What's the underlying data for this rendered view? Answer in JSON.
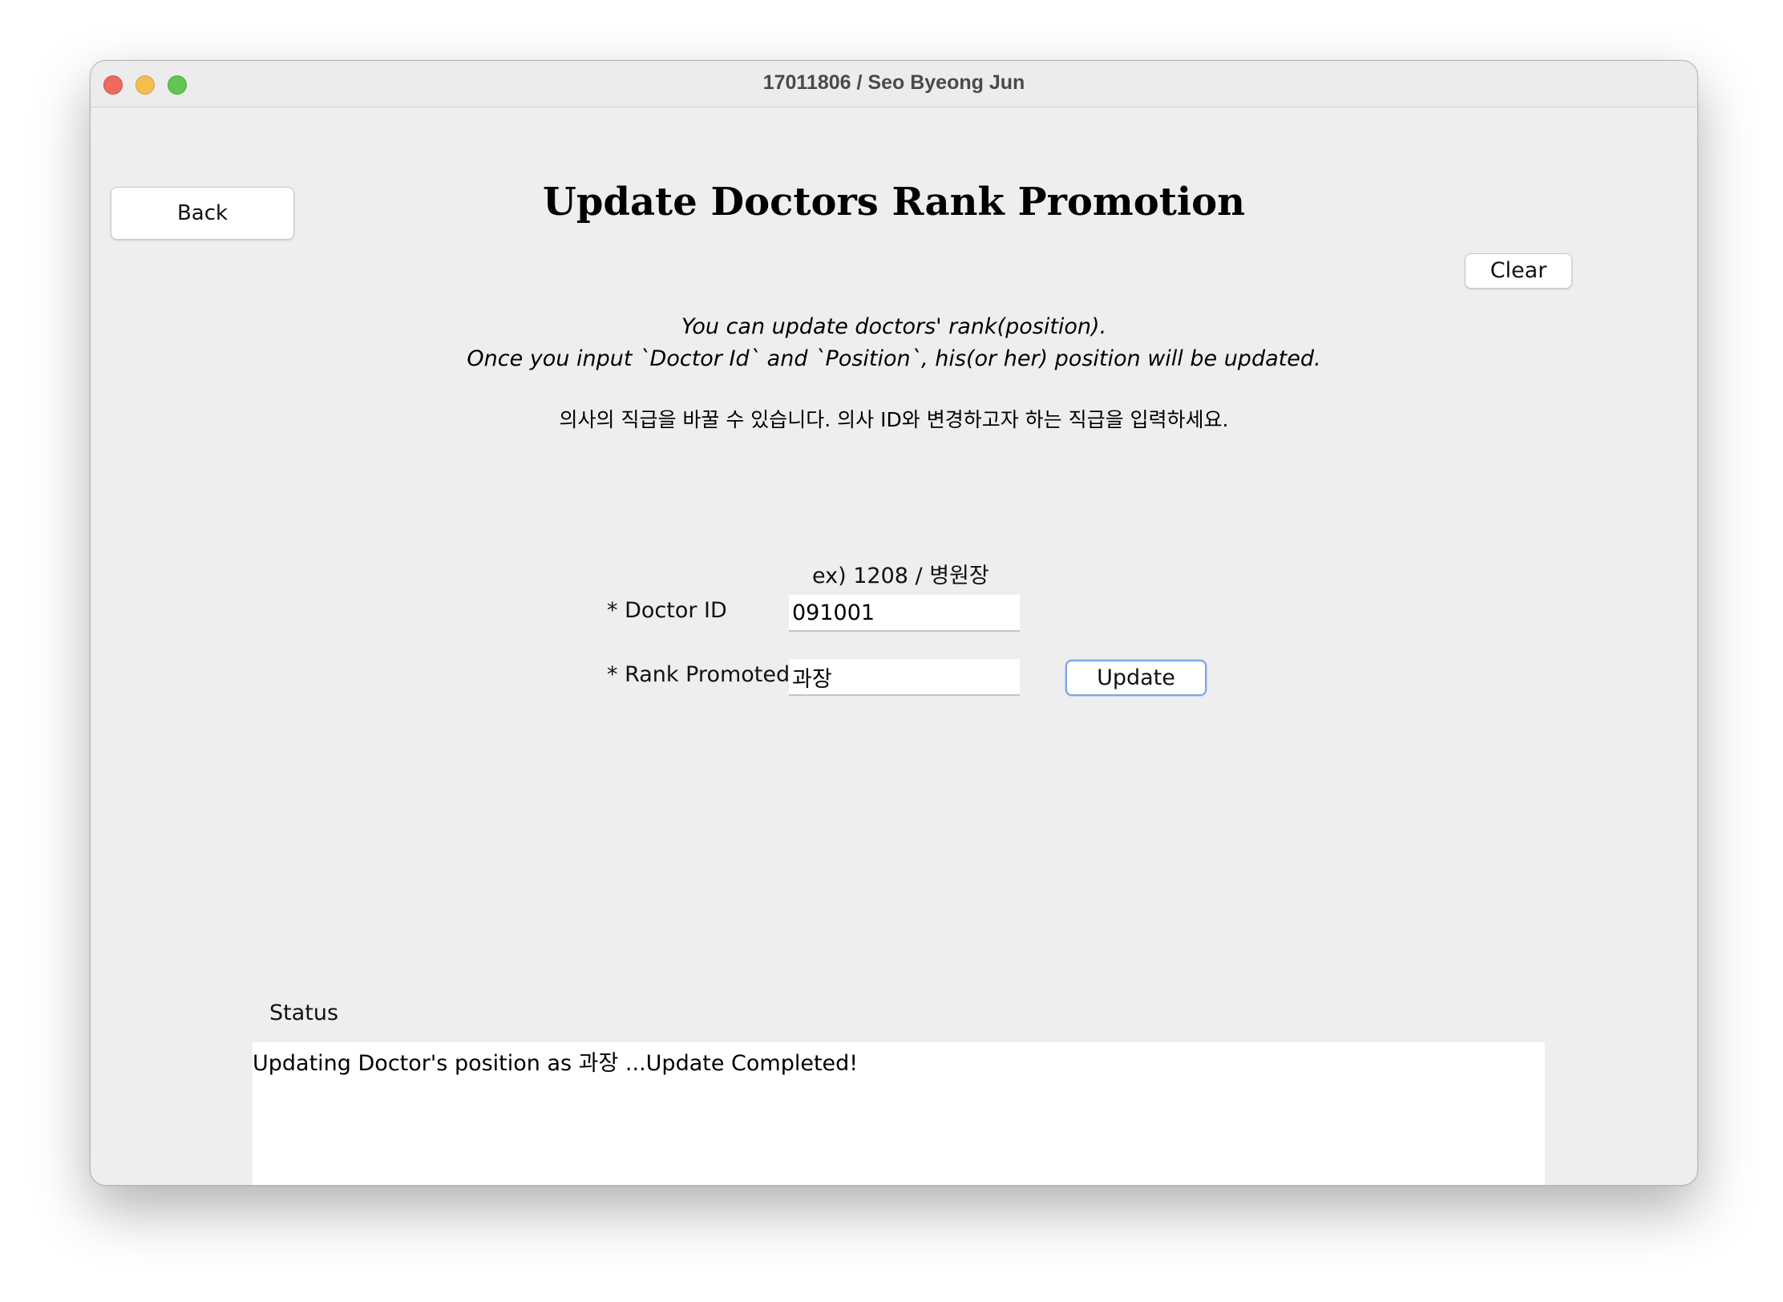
{
  "window": {
    "title": "17011806 / Seo Byeong Jun"
  },
  "toolbar": {
    "back_label": "Back",
    "clear_label": "Clear"
  },
  "page": {
    "title": "Update Doctors Rank Promotion",
    "description_line1": "You can update doctors' rank(position).",
    "description_line2": "Once you input `Doctor Id` and `Position`, his(or her) position will be updated.",
    "description_korean": "의사의 직급을 바꿀 수 있습니다. 의사 ID와 변경하고자 하는 직급을 입력하세요."
  },
  "form": {
    "example": "ex) 1208 / 병원장",
    "doctor_id_label": "* Doctor ID",
    "doctor_id_value": "091001",
    "rank_label": "* Rank Promoted",
    "rank_value": "과장",
    "update_label": "Update"
  },
  "status": {
    "label": "Status",
    "text": "Updating Doctor's position as 과장 ...Update Completed!"
  },
  "colors": {
    "close": "#ed6a5e",
    "minimize": "#f5bf4f",
    "maximize": "#61c554",
    "focus_ring": "#7aa7e6",
    "window_bg": "#eeeeee"
  }
}
